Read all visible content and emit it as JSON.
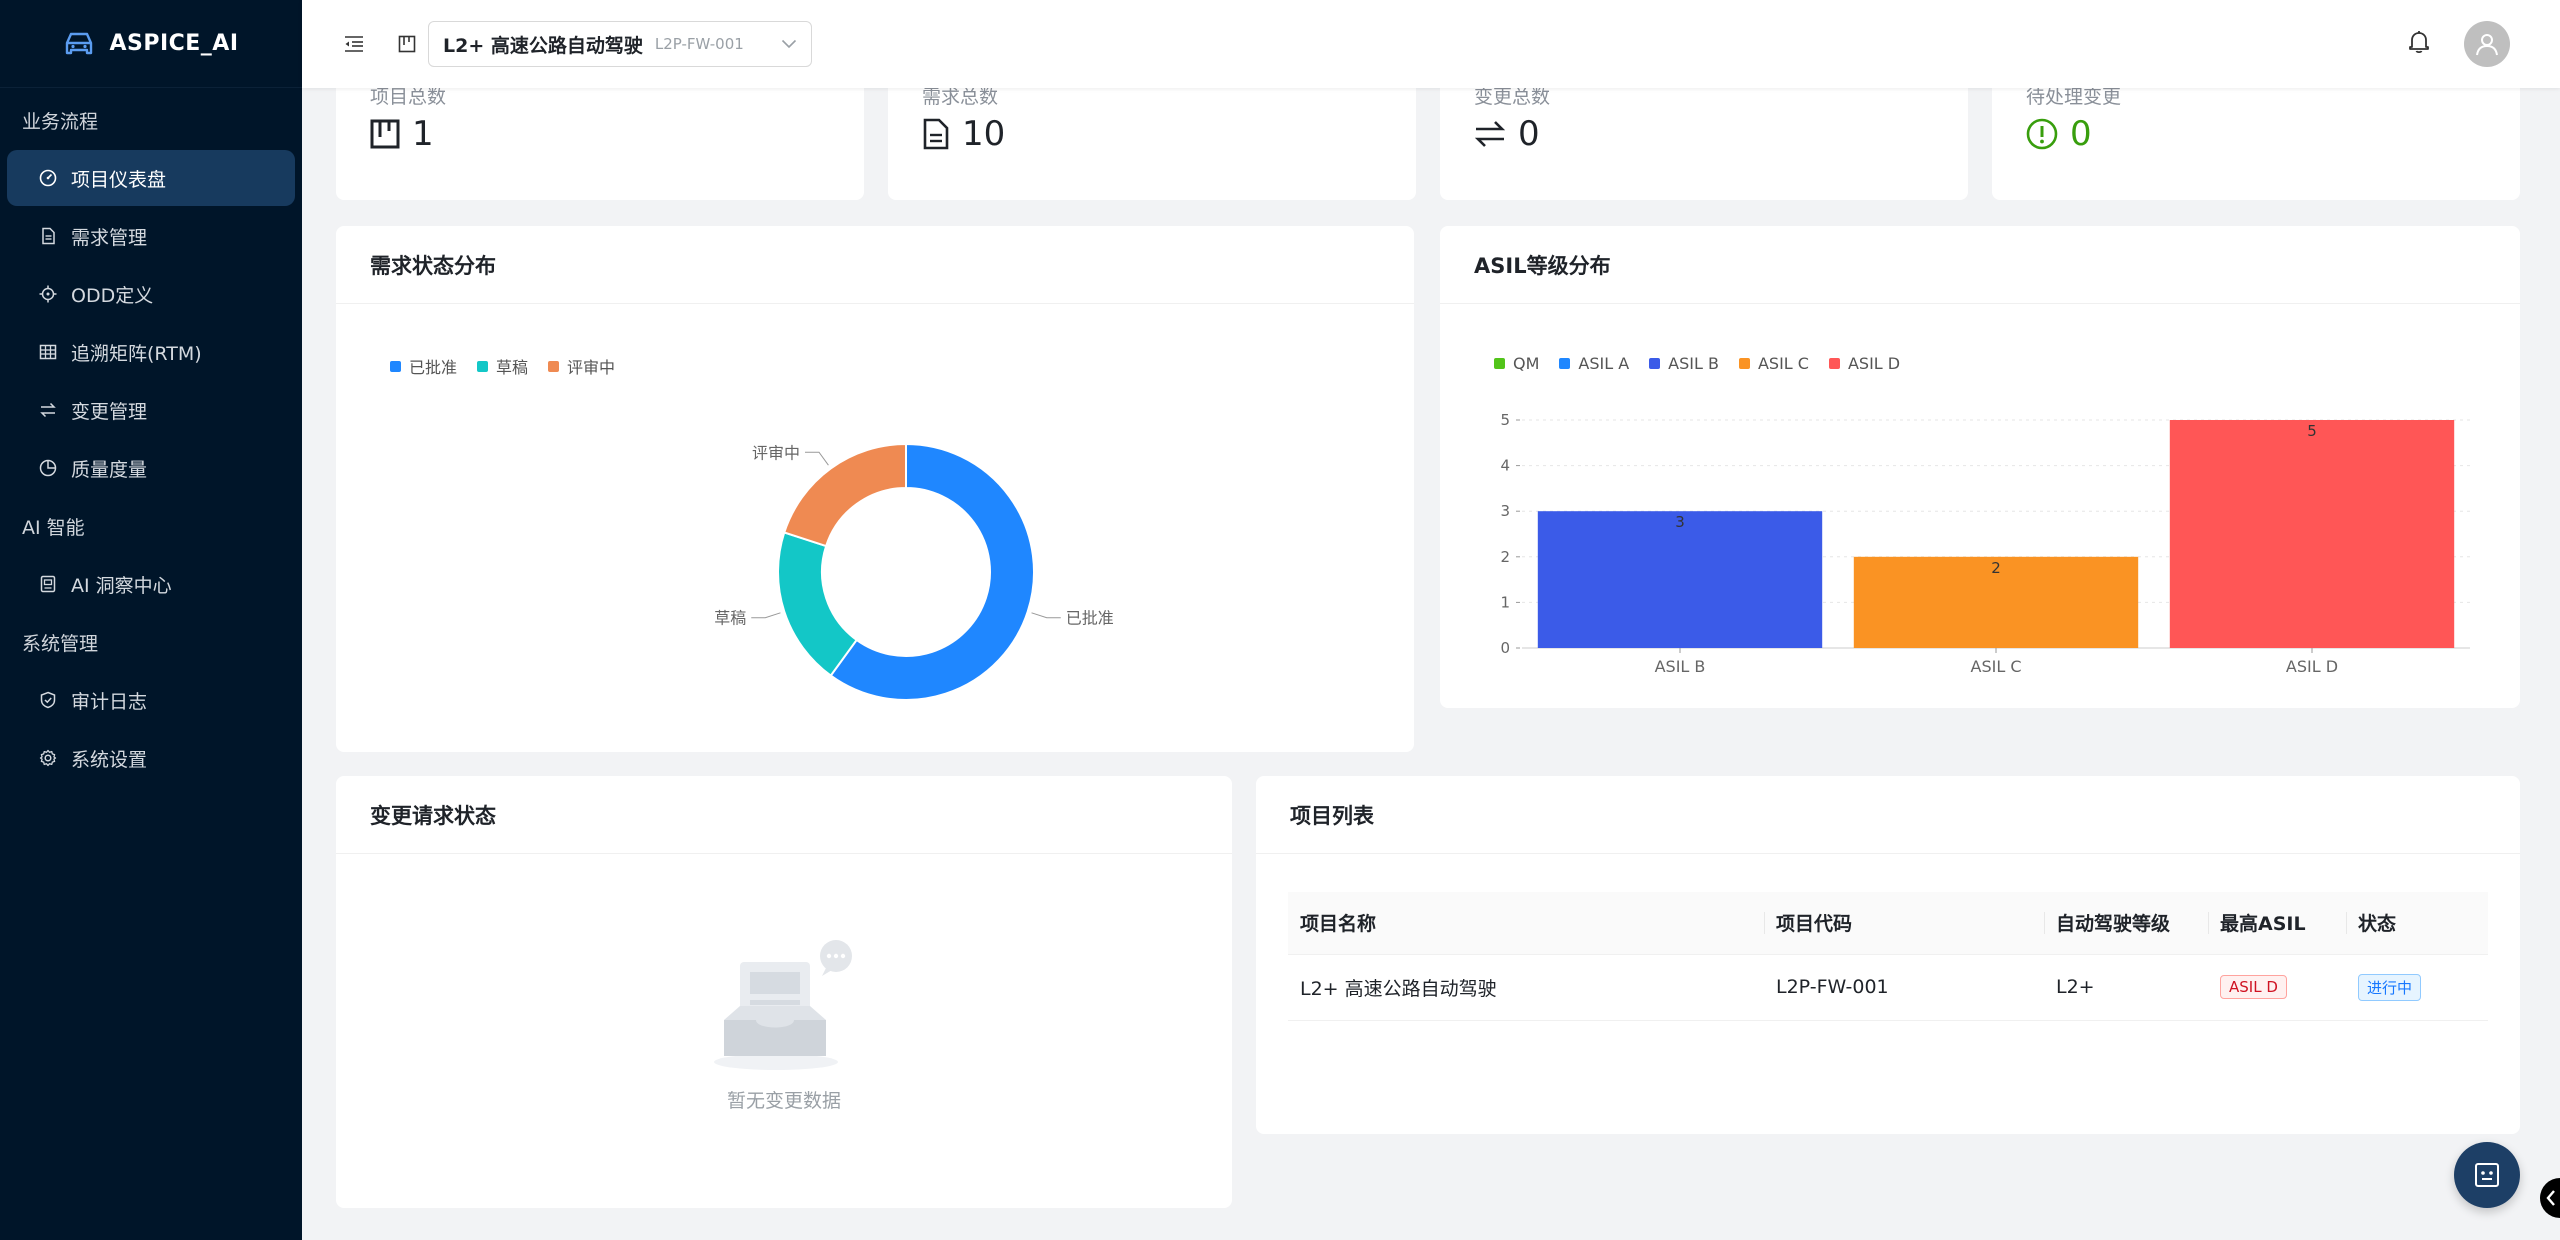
{
  "app": {
    "title": "ASPICE_AI"
  },
  "sidebar": {
    "groups": [
      {
        "title": "业务流程",
        "items": [
          {
            "label": "项目仪表盘",
            "icon": "dashboard-icon",
            "active": true
          },
          {
            "label": "需求管理",
            "icon": "file-icon"
          },
          {
            "label": "ODD定义",
            "icon": "target-icon"
          },
          {
            "label": "追溯矩阵(RTM)",
            "icon": "table-icon"
          },
          {
            "label": "变更管理",
            "icon": "swap-icon"
          },
          {
            "label": "质量度量",
            "icon": "pie-icon"
          }
        ]
      },
      {
        "title": "AI 智能",
        "items": [
          {
            "label": "AI 洞察中心",
            "icon": "robot-icon"
          }
        ]
      },
      {
        "title": "系统管理",
        "items": [
          {
            "label": "审计日志",
            "icon": "shield-icon"
          },
          {
            "label": "系统设置",
            "icon": "gear-icon"
          }
        ]
      }
    ]
  },
  "header": {
    "project_name": "L2+ 高速公路自动驾驶",
    "project_code": "L2P-FW-001"
  },
  "stats": [
    {
      "title": "项目总数",
      "value": "1",
      "icon": "project-icon",
      "color": "#1f2329"
    },
    {
      "title": "需求总数",
      "value": "10",
      "icon": "file-icon",
      "color": "#1f2329"
    },
    {
      "title": "变更总数",
      "value": "0",
      "icon": "swap-icon",
      "color": "#1f2329"
    },
    {
      "title": "待处理变更",
      "value": "0",
      "icon": "exclamation-circle-icon",
      "color": "#389e0d"
    }
  ],
  "requirement_status": {
    "title": "需求状态分布",
    "chart_data": {
      "type": "pie",
      "categories": [
        "已批准",
        "草稿",
        "评审中"
      ],
      "values": [
        6,
        2,
        2
      ],
      "colors": [
        "#1f87ff",
        "#13c7c7",
        "#ef8a52"
      ],
      "legend": "top-left"
    }
  },
  "asil_distribution": {
    "title": "ASIL等级分布",
    "legend": [
      {
        "name": "QM",
        "color": "#52c41a"
      },
      {
        "name": "ASIL A",
        "color": "#1f87ff"
      },
      {
        "name": "ASIL B",
        "color": "#3b5be8"
      },
      {
        "name": "ASIL C",
        "color": "#fa9323"
      },
      {
        "name": "ASIL D",
        "color": "#ff5656"
      }
    ],
    "chart_data": {
      "type": "bar",
      "categories": [
        "ASIL B",
        "ASIL C",
        "ASIL D"
      ],
      "values": [
        3,
        2,
        5
      ],
      "colors": [
        "#3b5be8",
        "#fa9323",
        "#ff5656"
      ],
      "ylim": [
        0,
        5
      ],
      "yticks": [
        0,
        1,
        2,
        3,
        4,
        5
      ],
      "grid": true,
      "legend": "top-left"
    }
  },
  "change_requests": {
    "title": "变更请求状态",
    "empty_text": "暂无变更数据"
  },
  "project_list": {
    "title": "项目列表",
    "columns": [
      "项目名称",
      "项目代码",
      "自动驾驶等级",
      "最高ASIL",
      "状态"
    ],
    "rows": [
      {
        "name": "L2+ 高速公路自动驾驶",
        "code": "L2P-FW-001",
        "level": "L2+",
        "asil": "ASIL D",
        "status": "进行中"
      }
    ]
  }
}
